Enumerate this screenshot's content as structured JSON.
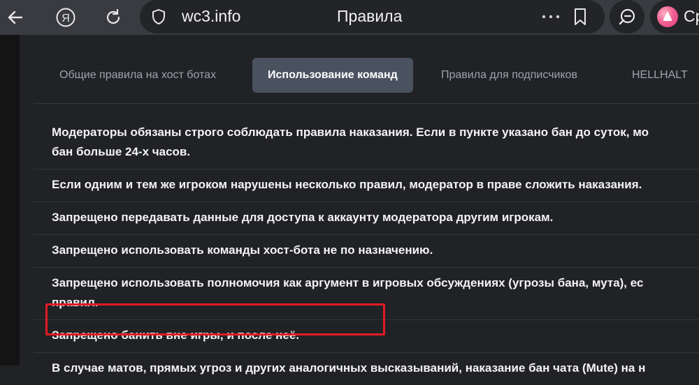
{
  "browser": {
    "domain": "wc3.info",
    "page_title": "Правила",
    "alice_label": "Ср",
    "accent": "#e21b23"
  },
  "icons": [
    "back-arrow-icon",
    "yandex-logo-icon",
    "reload-icon",
    "shield-icon",
    "more-dots-icon",
    "bookmark-icon",
    "search-chat-icon",
    "alice-icon"
  ],
  "tabs": [
    {
      "label": "Общие правила на хост ботах",
      "active": false
    },
    {
      "label": "Использование команд",
      "active": true
    },
    {
      "label": "Правила для подписчиков",
      "active": false
    },
    {
      "label": "HELLHALT",
      "active": false
    }
  ],
  "rules": [
    {
      "line1": "Модераторы обязаны строго соблюдать правила наказания. Если в пункте указано бан до суток, мо",
      "line2": "бан больше 24-х часов."
    },
    {
      "line1": "Если одним и тем же игроком нарушены несколько правил, модератор в праве сложить наказания."
    },
    {
      "line1": "Запрещено передавать данные для доступа к аккаунту модератора другим игрокам."
    },
    {
      "line1": "Запрещено использовать команды хост-бота не по назначению."
    },
    {
      "line1": "Запрещено использовать полномочия как аргумент в игровых обсуждениях (угрозы бана, мута), ес",
      "line2": "правил."
    },
    {
      "line1": "Запрещено банить вне игры, и после неё."
    },
    {
      "line1": "В случае матов, прямых угроз и других аналогичных высказываний, наказание бан чата (Mute) на н"
    }
  ]
}
